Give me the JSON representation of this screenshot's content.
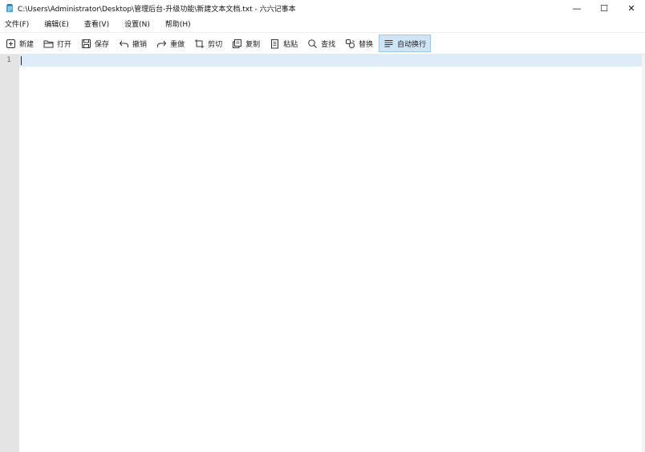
{
  "window": {
    "title": "C:\\Users\\Administrator\\Desktop\\管理后台-升级功能\\新建文本文档.txt - 六六记事本",
    "controls": {
      "minimize": "—",
      "maximize": "☐",
      "close": "✕"
    }
  },
  "menubar": {
    "items": [
      {
        "label": "文件(F)"
      },
      {
        "label": "编辑(E)"
      },
      {
        "label": "查看(V)"
      },
      {
        "label": "设置(N)"
      },
      {
        "label": "帮助(H)"
      }
    ]
  },
  "toolbar": {
    "buttons": [
      {
        "label": "新建",
        "icon": "new-file-icon"
      },
      {
        "label": "打开",
        "icon": "folder-icon"
      },
      {
        "label": "保存",
        "icon": "save-icon"
      },
      {
        "label": "撤销",
        "icon": "undo-icon"
      },
      {
        "label": "重做",
        "icon": "redo-icon"
      },
      {
        "label": "剪切",
        "icon": "cut-icon"
      },
      {
        "label": "复制",
        "icon": "copy-icon"
      },
      {
        "label": "粘贴",
        "icon": "paste-icon"
      },
      {
        "label": "查找",
        "icon": "search-icon"
      },
      {
        "label": "替换",
        "icon": "replace-icon"
      },
      {
        "label": "自动换行",
        "icon": "wrap-icon",
        "active": true
      }
    ]
  },
  "editor": {
    "line_numbers": [
      "1"
    ],
    "content": "",
    "current_line_color": "#ddecf8",
    "gutter_color": "#e4e4e4"
  }
}
